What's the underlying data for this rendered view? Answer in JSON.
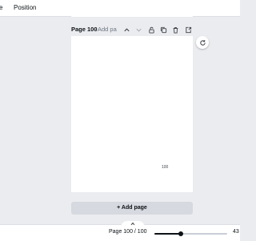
{
  "toolbar": {
    "partial_item_label": "e",
    "position_label": "Position"
  },
  "page": {
    "label": "Page 100",
    "separator": "-",
    "title_placeholder": "Add pa",
    "number_text": "100",
    "icons": [
      "chevron-up",
      "chevron-down",
      "lock",
      "duplicate",
      "trash",
      "add-page"
    ]
  },
  "canvas_actions": {
    "refresh_icon": "refresh-icon"
  },
  "add_page": {
    "label": "+ Add page"
  },
  "footer": {
    "page_counter": "Page 100 / 100",
    "zoom_label": "43",
    "zoom_fraction": 0.36,
    "collapse_icon": "chevron-up"
  },
  "colors": {
    "workspace_bg": "#ebecf0",
    "page_bg": "#ffffff",
    "button_bg": "#d6d9df",
    "text": "#0d1216",
    "muted_text": "#6d7580"
  }
}
